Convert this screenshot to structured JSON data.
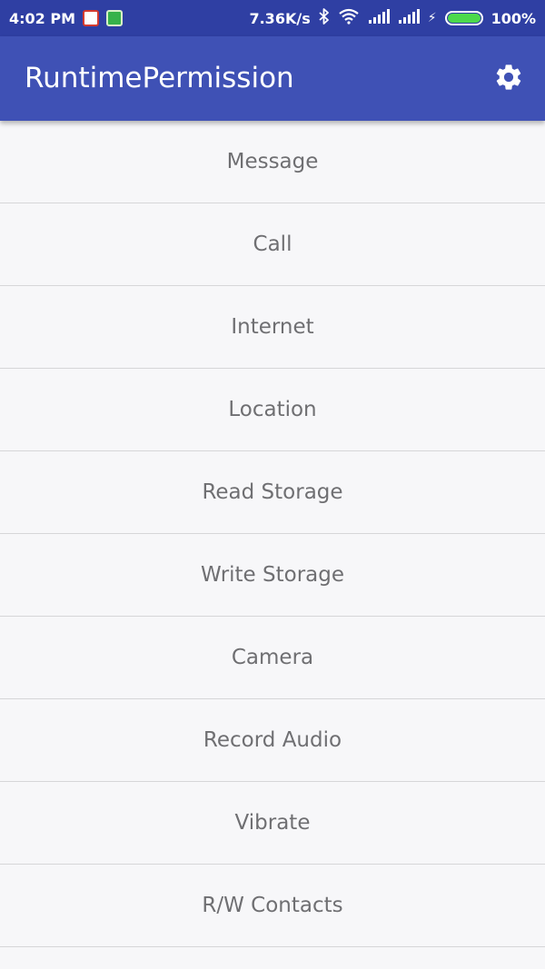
{
  "status_bar": {
    "time": "4:02 PM",
    "notification_icons": [
      "shield-icon",
      "android-icon"
    ],
    "net_speed": "7.36K/s",
    "battery_percent": "100%",
    "battery_level": 1.0,
    "battery_color": "#4cd94c"
  },
  "app_bar": {
    "title": "RuntimePermission",
    "settings_icon": "gear-icon",
    "color": "#3f51b5"
  },
  "permissions": [
    {
      "label": "Message"
    },
    {
      "label": "Call"
    },
    {
      "label": "Internet"
    },
    {
      "label": "Location"
    },
    {
      "label": "Read Storage"
    },
    {
      "label": "Write Storage"
    },
    {
      "label": "Camera"
    },
    {
      "label": "Record Audio"
    },
    {
      "label": "Vibrate"
    },
    {
      "label": "R/W Contacts"
    }
  ]
}
